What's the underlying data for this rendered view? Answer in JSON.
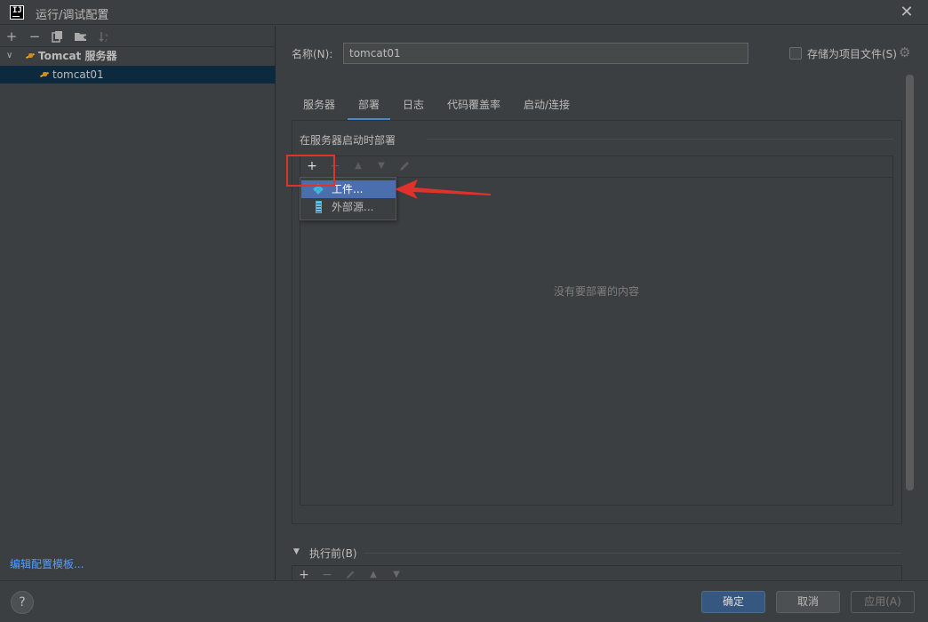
{
  "window": {
    "title": "运行/调试配置",
    "app_icon_text": "IJ"
  },
  "left_toolbar": {
    "icons": [
      "add-icon",
      "remove-icon",
      "copy-icon",
      "folder-icon",
      "sort-icon"
    ]
  },
  "tree": {
    "items": [
      {
        "label": "Tomcat 服务器",
        "expanded": true,
        "bold": true
      },
      {
        "label": "tomcat01",
        "selected": true
      }
    ]
  },
  "edit_template_link": "编辑配置模板...",
  "name_field": {
    "label": "名称(N):",
    "value": "tomcat01"
  },
  "store_as_project_file": {
    "label": "存储为项目文件(S)",
    "checked": false
  },
  "tabs": [
    {
      "label": "服务器",
      "active": false
    },
    {
      "label": "部署",
      "active": true
    },
    {
      "label": "日志",
      "active": false
    },
    {
      "label": "代码覆盖率",
      "active": false
    },
    {
      "label": "启动/连接",
      "active": false
    }
  ],
  "deployment": {
    "section_label": "在服务器启动时部署",
    "empty_text": "没有要部署的内容",
    "popup_menu": [
      {
        "label": "工件...",
        "icon": "artifact-icon",
        "highlighted": true
      },
      {
        "label": "外部源...",
        "icon": "external-source-icon",
        "highlighted": false
      }
    ]
  },
  "before_launch": {
    "label": "执行前(B)",
    "collapsed": false
  },
  "buttons": {
    "help": "?",
    "ok": "确定",
    "cancel": "取消",
    "apply": "应用(A)"
  },
  "colors": {
    "accent": "#4a88c7",
    "highlight": "#4b6eaf",
    "annotation": "#e0312b",
    "link": "#589df6",
    "background": "#3c3f41"
  }
}
